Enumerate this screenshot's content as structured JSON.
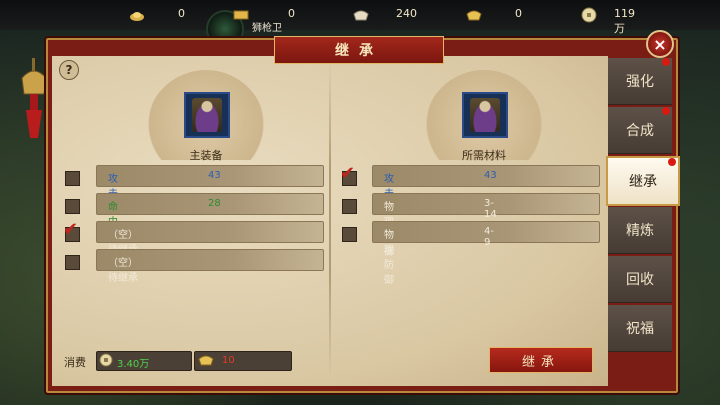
{
  "resources": [
    {
      "icon": "gold-ingot-icon",
      "value": "0"
    },
    {
      "icon": "gold-bar-icon",
      "value": "0"
    },
    {
      "icon": "silver-ingot-icon",
      "value": "240"
    },
    {
      "icon": "gold-ingot-icon",
      "value": "0"
    },
    {
      "icon": "coin-icon",
      "value": "119万"
    }
  ],
  "player": {
    "name": "狮枪卫"
  },
  "panel": {
    "title": "继承",
    "close_label": "×",
    "help_label": "?"
  },
  "left": {
    "label": "主装备",
    "rows": [
      {
        "name": "攻击",
        "value": "43",
        "name_color": "#2b5fb0",
        "value_color": "#2b5fb0",
        "checked": false
      },
      {
        "name": "命中",
        "value": "28",
        "name_color": "#2e8a2e",
        "value_color": "#2e8a2e",
        "checked": false
      },
      {
        "name": "（空）待继承",
        "value": "",
        "name_color": "#f2ead8",
        "value_color": "#f2ead8",
        "checked": true
      },
      {
        "name": "（空）待继承",
        "value": "",
        "name_color": "#f2ead8",
        "value_color": "#f2ead8",
        "checked": false
      }
    ]
  },
  "right": {
    "label": "所需材料",
    "rows": [
      {
        "name": "攻击",
        "value": "43",
        "name_color": "#2b5fb0",
        "value_color": "#2b5fb0",
        "checked": true
      },
      {
        "name": "物理防御",
        "value": "3-14",
        "name_color": "#f2ead8",
        "value_color": "#f2ead8",
        "checked": false
      },
      {
        "name": "物理防御",
        "value": "4-9",
        "name_color": "#f2ead8",
        "value_color": "#f2ead8",
        "checked": false
      }
    ]
  },
  "tabs": [
    {
      "label": "强化",
      "dot": true,
      "active": false
    },
    {
      "label": "合成",
      "dot": true,
      "active": false
    },
    {
      "label": "继承",
      "dot": true,
      "active": true
    },
    {
      "label": "精炼",
      "dot": false,
      "active": false
    },
    {
      "label": "回收",
      "dot": false,
      "active": false
    },
    {
      "label": "祝福",
      "dot": false,
      "active": false
    }
  ],
  "cost": {
    "label": "消费",
    "coin_value": "3.40万",
    "coin_color": "#4fd14f",
    "ingot_value": "10",
    "ingot_color": "#e03a2a"
  },
  "action": {
    "inherit_label": "继承"
  }
}
